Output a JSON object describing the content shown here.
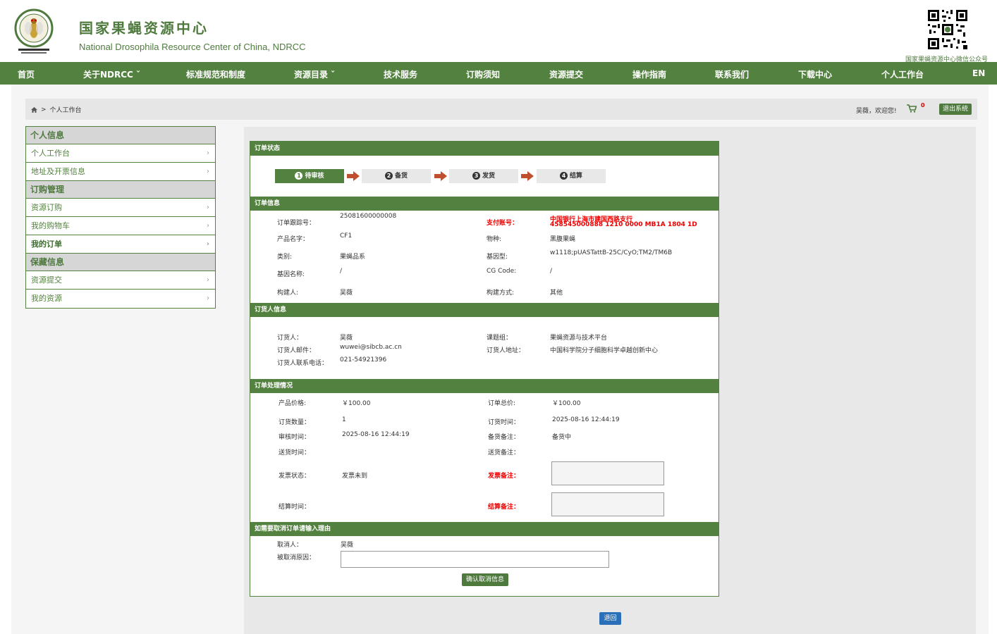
{
  "header": {
    "title": "国家果蝇资源中心",
    "subtitle": "National Drosophila Resource Center of China, NDRCC",
    "qr_caption": "国家果蝇资源中心微信公众号"
  },
  "nav": [
    "首页",
    "关于NDRCC ˇ",
    "标准规范和制度",
    "资源目录 ˇ",
    "技术服务",
    "订购须知",
    "资源提交",
    "操作指南",
    "联系我们",
    "下载中心",
    "个人工作台",
    "EN"
  ],
  "breadcrumb": {
    "separator": ">",
    "current": "个人工作台"
  },
  "user": {
    "welcome": "吴薇，欢迎您!",
    "cart_count": "0",
    "logout": "退出系统"
  },
  "sidebar": {
    "personal_head": "个人信息",
    "personal_items": [
      "个人工作台",
      "地址及开票信息"
    ],
    "order_head": "订购管理",
    "order_items": [
      "资源订购",
      "我的购物车",
      "我的订单"
    ],
    "deposit_head": "保藏信息",
    "deposit_items": [
      "资源提交",
      "我的资源"
    ]
  },
  "order_status": {
    "head": "订单状态",
    "steps": [
      {
        "num": "1",
        "label": "待审核"
      },
      {
        "num": "2",
        "label": "备货"
      },
      {
        "num": "3",
        "label": "发货"
      },
      {
        "num": "4",
        "label": "结算"
      }
    ]
  },
  "order_info": {
    "head": "订单信息",
    "tracking_label": "订单跟踪号：",
    "tracking": "25081600000008",
    "pay_label": "支付账号：",
    "pay_bank": "中国银行上海市建国西路支行",
    "pay_account": "458545000888  1210 0000 MB1A 1804 1D",
    "product_label": "产品名字：",
    "product": "CF1",
    "species_label": "物种:",
    "species": "黑腹果蝇",
    "category_label": "类别:",
    "category": "果蝇品系",
    "genotype_label": "基因型:",
    "genotype": "w1118;pUASTattB-25C/CyO;TM2/TM6B",
    "gene_label": "基因名称:",
    "gene": "/",
    "cg_label": "CG Code:",
    "cg": "/",
    "builder_label": "构建人:",
    "builder": "吴薇",
    "method_label": "构建方式:",
    "method": "其他"
  },
  "buyer_info": {
    "head": "订货人信息",
    "name_label": "订货人：",
    "name": "吴薇",
    "group_label": "课题组：",
    "group": "果蝇资源与技术平台",
    "email_label": "订货人邮件：",
    "email": "wuwei@sibcb.ac.cn",
    "address_label": "订货人地址：",
    "address": "中国科学院分子细胞科学卓越创新中心",
    "phone_label": "订货人联系电话：",
    "phone": "021-54921396"
  },
  "processing": {
    "head": "订单处理情况",
    "price_label": "产品价格:",
    "price": "￥100.00",
    "total_label": "订单总价:",
    "total": "￥100.00",
    "qty_label": "订货数量：",
    "qty": "1",
    "order_time_label": "订货时间：",
    "order_time": "2025-08-16 12:44:19",
    "review_time_label": "审核时间：",
    "review_time": "2025-08-16 12:44:19",
    "stock_note_label": "备货备注：",
    "stock_note": "备货中",
    "ship_time_label": "送货时间：",
    "ship_note_label": "送货备注：",
    "invoice_status_label": "发票状态：",
    "invoice_status": "发票未到",
    "invoice_note_label": "发票备注：",
    "settle_time_label": "结算时间：",
    "settle_note_label": "结算备注："
  },
  "cancel": {
    "head": "如需要取消订单请输入理由",
    "canceller_label": "取消人：",
    "canceller": "吴薇",
    "reason_label": "被取消原因：",
    "confirm": "确认取消信息"
  },
  "back": "退回",
  "colors": {
    "primary_green": "#53813f",
    "alert_red": "#ee0000",
    "back_blue": "#2a6fb8"
  }
}
